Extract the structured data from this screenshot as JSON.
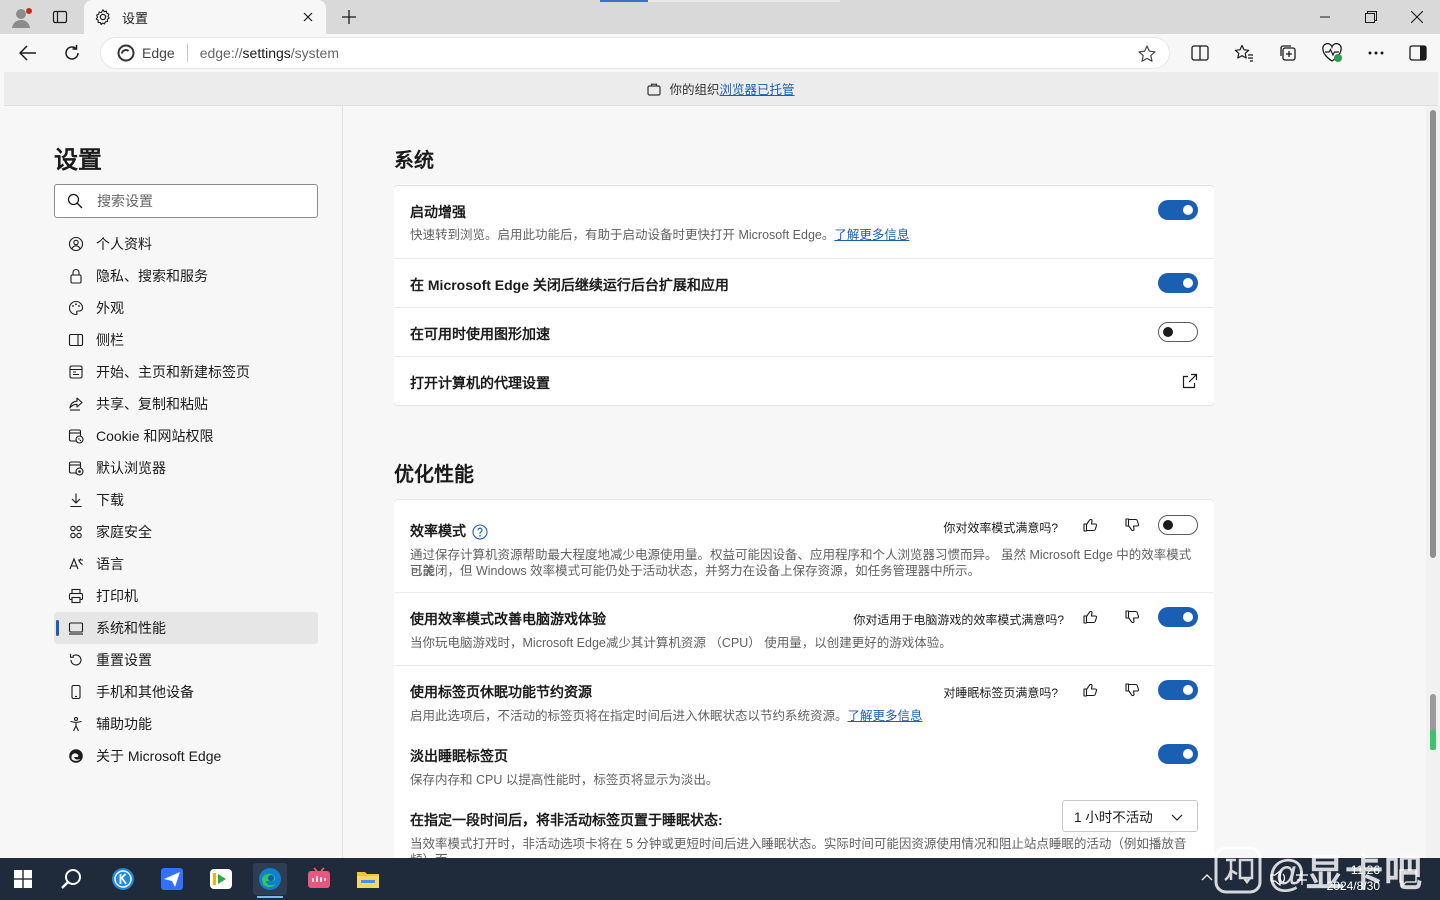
{
  "tab": {
    "title": "设置"
  },
  "address": {
    "site_label": "Edge",
    "url_prefix": "edge://",
    "url_host": "settings",
    "url_path": "/system"
  },
  "banner": {
    "prefix": "你的组织",
    "link": "浏览器已托管"
  },
  "sidebar": {
    "heading": "设置",
    "search_placeholder": "搜索设置",
    "items": [
      {
        "label": "个人资料",
        "icon": "profile-icon"
      },
      {
        "label": "隐私、搜索和服务",
        "icon": "lock-icon"
      },
      {
        "label": "外观",
        "icon": "appearance-icon"
      },
      {
        "label": "侧栏",
        "icon": "sidebar-icon"
      },
      {
        "label": "开始、主页和新建标签页",
        "icon": "home-icon"
      },
      {
        "label": "共享、复制和粘贴",
        "icon": "share-icon"
      },
      {
        "label": "Cookie 和网站权限",
        "icon": "cookie-icon"
      },
      {
        "label": "默认浏览器",
        "icon": "browser-icon"
      },
      {
        "label": "下载",
        "icon": "download-icon"
      },
      {
        "label": "家庭安全",
        "icon": "family-icon"
      },
      {
        "label": "语言",
        "icon": "language-icon"
      },
      {
        "label": "打印机",
        "icon": "printer-icon"
      },
      {
        "label": "系统和性能",
        "icon": "system-icon"
      },
      {
        "label": "重置设置",
        "icon": "reset-icon"
      },
      {
        "label": "手机和其他设备",
        "icon": "phone-icon"
      },
      {
        "label": "辅助功能",
        "icon": "accessibility-icon"
      },
      {
        "label": "关于 Microsoft Edge",
        "icon": "edge-icon"
      }
    ],
    "active_index": 12
  },
  "system": {
    "title": "系统",
    "rows": [
      {
        "title": "启动增强",
        "desc": "快速转到浏览。启用此功能后，有助于启动设备时更快打开 Microsoft Edge。",
        "link": "了解更多信息",
        "state": "on"
      },
      {
        "title": "在 Microsoft Edge 关闭后继续运行后台扩展和应用",
        "state": "on"
      },
      {
        "title": "在可用时使用图形加速",
        "state": "off"
      },
      {
        "title": "打开计算机的代理设置"
      }
    ]
  },
  "performance": {
    "title": "优化性能",
    "efficiency": {
      "title": "效率模式",
      "feedback": "你对效率模式满意吗?",
      "desc1": "通过保存计算机资源帮助最大程度地减少电源使用量。权益可能因设备、应用程序和个人浏览器习惯而异。 虽然 Microsoft Edge 中的效率模式可能",
      "desc2": "已关闭，但 Windows 效率模式可能仍处于活动状态，并努力在设备上保存资源，如任务管理器中所示。",
      "state": "off"
    },
    "gaming": {
      "title": "使用效率模式改善电脑游戏体验",
      "feedback": "你对适用于电脑游戏的效率模式满意吗?",
      "desc": "当你玩电脑游戏时，Microsoft Edge减少其计算机资源 （CPU） 使用量，以创建更好的游戏体验。",
      "state": "on"
    },
    "sleeping": {
      "title": "使用标签页休眠功能节约资源",
      "feedback": "对睡眠标签页满意吗?",
      "desc": "启用此选项后，不活动的标签页将在指定时间后进入休眠状态以节约系统资源。",
      "link": "了解更多信息",
      "state": "on"
    },
    "fade": {
      "title": "淡出睡眠标签页",
      "desc": "保存内存和 CPU 以提高性能时，标签页将显示为淡出。",
      "state": "on"
    },
    "sleep_after": {
      "title": "在指定一段时间后，将非活动标签页置于睡眠状态:",
      "value": "1 小时不活动",
      "desc": "当效率模式打开时，非活动选项卡将在 5 分钟或更短时间后进入睡眠状态。实际时间可能因资源使用情况和阻止站点睡眠的活动（例如播放音频）而"
    }
  },
  "taskbar": {
    "time": "11:26",
    "date": "2024/8/30"
  },
  "watermark": {
    "text": "@显卡吧"
  },
  "colors": {
    "accent": "#1a5fb4",
    "taskbar": "#1f2a3a"
  }
}
